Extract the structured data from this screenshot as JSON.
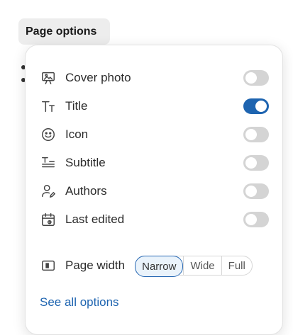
{
  "trigger": {
    "label": "Page options"
  },
  "options": [
    {
      "label": "Cover photo",
      "icon": "cover-photo-icon",
      "enabled": false
    },
    {
      "label": "Title",
      "icon": "title-icon",
      "enabled": true
    },
    {
      "label": "Icon",
      "icon": "smiley-icon",
      "enabled": false
    },
    {
      "label": "Subtitle",
      "icon": "subtitle-icon",
      "enabled": false
    },
    {
      "label": "Authors",
      "icon": "authors-icon",
      "enabled": false
    },
    {
      "label": "Last edited",
      "icon": "calendar-icon",
      "enabled": false
    }
  ],
  "page_width": {
    "label": "Page width",
    "icon": "page-width-icon",
    "choices": [
      "Narrow",
      "Wide",
      "Full"
    ],
    "selected": "Narrow"
  },
  "see_all": {
    "label": "See all options"
  },
  "colors": {
    "accent": "#1e64b0",
    "toggle_off": "#d4d4d4"
  }
}
